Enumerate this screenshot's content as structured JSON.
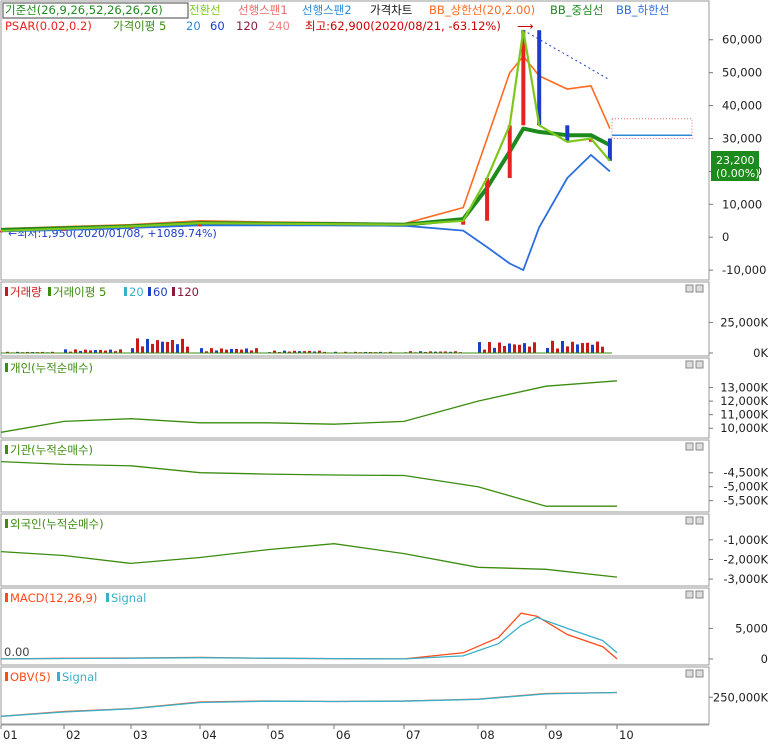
{
  "colors": {
    "price_up": "#e8231f",
    "price_down": "#1a3ec8",
    "ichimoku_base": "#1a7a1a",
    "conversion": "#7ec81c",
    "leading_span1": "#e86c6c",
    "leading_span2": "#2a8ad8",
    "bb_upper": "#ff6a20",
    "bb_middle": "#1d8a1d",
    "bb_lower": "#2c6ee0",
    "volume": "#c81818",
    "green_line": "#3c8c10",
    "macd": "#ff4a1a",
    "signal": "#38b0c8",
    "last_price_bg": "#1d8a1d"
  },
  "panels": {
    "price": {
      "legend_row1": [
        "기준선(26,9,26,52,26,26,26)",
        "전환선",
        "선행스팬1",
        "선행스팬2",
        "가격차트",
        "BB_상한선(20,2.00)",
        "BB_중심선",
        "BB_하한선"
      ],
      "legend_row2": [
        "PSAR(0.02,0.2)",
        "가격이평 5",
        "20",
        "60",
        "120",
        "240"
      ],
      "high_annotation": "최고:62,900(2020/08/21, -63.12%)",
      "low_annotation": "←최저:1,950(2020/01/08, +1089.74%)",
      "last_price": "23,200",
      "last_change": "(0.00%)",
      "yticks": [
        "60,000",
        "50,000",
        "40,000",
        "30,000",
        "20,000",
        "10,000",
        "0",
        "-10,000"
      ]
    },
    "volume": {
      "legend": [
        "거래량",
        "거래이평 5",
        "20",
        "60",
        "120"
      ],
      "yticks": [
        "25,000K",
        "0K"
      ]
    },
    "individual": {
      "legend": [
        "개인(누적순매수)"
      ],
      "yticks": [
        "13,000K",
        "12,000K",
        "11,000K",
        "10,000K"
      ]
    },
    "institution": {
      "legend": [
        "기관(누적순매수)"
      ],
      "yticks": [
        "-4,500K",
        "-5,000K",
        "-5,500K"
      ]
    },
    "foreign": {
      "legend": [
        "외국인(누적순매수)"
      ],
      "yticks": [
        "-1,000K",
        "-2,000K",
        "-3,000K"
      ]
    },
    "macd": {
      "legend": [
        "MACD(12,26,9)",
        "Signal"
      ],
      "yticks": [
        "5,000",
        "0"
      ],
      "left_label": "0.00"
    },
    "obv": {
      "legend": [
        "OBV(5)",
        "Signal"
      ],
      "yticks": [
        "250,000K"
      ]
    }
  },
  "x_axis": [
    "01",
    "02",
    "03",
    "04",
    "05",
    "06",
    "07",
    "08",
    "09",
    "10"
  ],
  "chart_data": [
    {
      "type": "line",
      "title": "가격차트",
      "x": [
        "2020-01",
        "2020-02",
        "2020-03",
        "2020-04",
        "2020-05",
        "2020-06",
        "2020-07",
        "2020-07-25",
        "2020-08-05",
        "2020-08-15",
        "2020-08-21",
        "2020-08-28",
        "2020-09-10",
        "2020-09-20",
        "2020-09-28"
      ],
      "series": [
        {
          "name": "가격차트",
          "values": [
            1950,
            2600,
            3300,
            4300,
            4100,
            4000,
            3800,
            5000,
            18000,
            34000,
            62900,
            34000,
            29000,
            30000,
            23200
          ]
        },
        {
          "name": "BB_상한선(20,2.00)",
          "values": [
            2600,
            3200,
            3800,
            5000,
            4600,
            4400,
            4100,
            9000,
            30000,
            50000,
            55000,
            49000,
            45000,
            46000,
            33000
          ]
        },
        {
          "name": "BB_중심선",
          "values": [
            2200,
            2700,
            3300,
            4300,
            4100,
            4000,
            3800,
            5500,
            15000,
            26000,
            33000,
            32000,
            31000,
            31000,
            28000
          ]
        },
        {
          "name": "BB_하한선",
          "values": [
            1800,
            2200,
            2800,
            3600,
            3600,
            3600,
            3500,
            2000,
            -3000,
            -8000,
            -10000,
            3000,
            18000,
            25000,
            20000
          ]
        }
      ],
      "ylim": [
        -13000,
        66000
      ]
    },
    {
      "type": "bar",
      "title": "거래량",
      "categories": [
        "01",
        "02",
        "03",
        "04",
        "05",
        "06",
        "07",
        "08",
        "09",
        "10"
      ],
      "series": [
        {
          "name": "거래량",
          "values": [
            1000,
            3000,
            12000,
            4000,
            2000,
            1000,
            1500,
            9000,
            10000,
            2000
          ]
        }
      ],
      "ylim": [
        0,
        45000
      ]
    },
    {
      "type": "line",
      "title": "개인(누적순매수)",
      "x": [
        "01",
        "02",
        "03",
        "04",
        "05",
        "06",
        "07",
        "08",
        "09",
        "10"
      ],
      "series": [
        {
          "name": "개인(누적순매수)",
          "values": [
            9700,
            10500,
            10700,
            10400,
            10400,
            10300,
            10500,
            12000,
            13100,
            13500
          ]
        }
      ],
      "ylim": [
        9500,
        14000
      ]
    },
    {
      "type": "line",
      "title": "기관(누적순매수)",
      "x": [
        "01",
        "02",
        "03",
        "04",
        "05",
        "06",
        "07",
        "08",
        "09",
        "10"
      ],
      "series": [
        {
          "name": "기관(누적순매수)",
          "values": [
            -4100,
            -4200,
            -4250,
            -4500,
            -4550,
            -4580,
            -4600,
            -5000,
            -5700,
            -5700
          ]
        }
      ],
      "ylim": [
        -5800,
        -3900
      ]
    },
    {
      "type": "line",
      "title": "외국인(누적순매수)",
      "x": [
        "01",
        "02",
        "03",
        "04",
        "05",
        "06",
        "07",
        "08",
        "09",
        "10"
      ],
      "series": [
        {
          "name": "외국인(누적순매수)",
          "values": [
            -1600,
            -1800,
            -2200,
            -1900,
            -1500,
            -1200,
            -1700,
            -2400,
            -2500,
            -2900
          ]
        }
      ],
      "ylim": [
        -3200,
        -500
      ]
    },
    {
      "type": "line",
      "title": "MACD(12,26,9)",
      "x": [
        "01",
        "02",
        "03",
        "04",
        "05",
        "06",
        "07",
        "07-25",
        "08-10",
        "08-20",
        "08-27",
        "09-10",
        "09-25",
        "10"
      ],
      "series": [
        {
          "name": "MACD(12,26,9)",
          "values": [
            0,
            100,
            150,
            250,
            100,
            50,
            0,
            1000,
            3500,
            7500,
            7000,
            4000,
            2000,
            0
          ]
        },
        {
          "name": "Signal",
          "values": [
            0,
            80,
            130,
            200,
            120,
            60,
            0,
            500,
            2500,
            5500,
            6800,
            5000,
            3000,
            1000
          ]
        }
      ],
      "ylim": [
        -500,
        9000
      ]
    },
    {
      "type": "line",
      "title": "OBV(5)",
      "x": [
        "01",
        "02",
        "03",
        "04",
        "05",
        "06",
        "07",
        "08",
        "09",
        "10"
      ],
      "series": [
        {
          "name": "OBV(5)",
          "values": [
            50000,
            100000,
            130000,
            200000,
            210000,
            205000,
            210000,
            230000,
            290000,
            300000
          ]
        },
        {
          "name": "Signal",
          "values": [
            50000,
            95000,
            128000,
            195000,
            208000,
            205000,
            208000,
            228000,
            285000,
            300000
          ]
        }
      ],
      "ylim": [
        0,
        400000
      ]
    }
  ]
}
